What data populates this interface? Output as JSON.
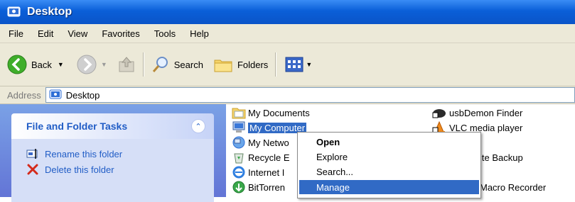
{
  "window": {
    "title": "Desktop"
  },
  "menu": [
    "File",
    "Edit",
    "View",
    "Favorites",
    "Tools",
    "Help"
  ],
  "toolbar": {
    "back": "Back",
    "search": "Search",
    "folders": "Folders"
  },
  "address": {
    "label": "Address",
    "value": "Desktop"
  },
  "tasks": {
    "header": "File and Folder Tasks",
    "items": [
      "Rename this folder",
      "Delete this folder"
    ]
  },
  "files": {
    "left": [
      "My Documents",
      "My Computer",
      "My Netwo",
      "Recycle E",
      "Internet I",
      "BitTorren"
    ],
    "right": [
      "usbDemon Finder",
      "VLC media player",
      "ite Backup",
      "Macro Recorder"
    ]
  },
  "context_menu": {
    "items": [
      "Open",
      "Explore",
      "Search...",
      "Manage"
    ],
    "default_item": "Open",
    "highlighted_item": "Manage"
  },
  "colors": {
    "titlebar": "#0a5fd8",
    "selection": "#316ac5",
    "task_link": "#215dc6"
  }
}
